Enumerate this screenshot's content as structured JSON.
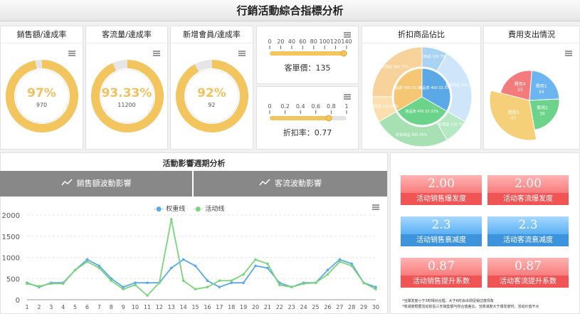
{
  "page_title": "行銷活動綜合指標分析",
  "gauges": [
    {
      "title": "銷售額/達成率",
      "value_text": "97%",
      "sub": "970",
      "percent": 97
    },
    {
      "title": "客流量/達成率",
      "value_text": "93.33%",
      "sub": "11200",
      "percent": 93.33
    },
    {
      "title": "新增會員/達成率",
      "value_text": "92%",
      "sub": "92",
      "percent": 92
    }
  ],
  "price_bar": {
    "ticks": [
      "0",
      "20",
      "40",
      "60",
      "80",
      "100",
      "120",
      "140"
    ],
    "label": "客單價：135",
    "value": 135,
    "max": 140
  },
  "discount_bar": {
    "ticks": [
      "0",
      "0.2",
      "0.4",
      "0.6",
      "0.8",
      "1"
    ],
    "label": "折扣率：0.77",
    "value": 0.77,
    "max": 1
  },
  "discount_pie": {
    "title": "折扣商品佔比",
    "inner_labels": [
      "商品表 400 33.33%",
      "商品表 400 33.33%",
      "商品表 400 33.33%"
    ],
    "outer_labels": [
      "折扣商品 100 75%",
      "折扣商品 300 25%",
      "折扣商品 100 75%",
      "折扣商品 300 25%",
      "折扣商品 100 25%",
      "折扣商品 300 75%"
    ]
  },
  "expense_pie": {
    "title": "費用支出情況",
    "slices": [
      {
        "label": "費用4",
        "value_text": "33",
        "value": 33,
        "color": "#f47b7b"
      },
      {
        "label": "費用1",
        "value_text": "34",
        "value": 34,
        "color": "#6cb5f0"
      },
      {
        "label": "費用2",
        "value_text": "34",
        "value": 34,
        "color": "#6bd48a"
      },
      {
        "label": "費用3",
        "value_text": "47",
        "value": 47,
        "color": "#f5d078"
      }
    ]
  },
  "cycle": {
    "title": "活動影響週期分析",
    "tab_sales": "銷售額波動影響",
    "tab_traffic": "客流波動影響",
    "legend_a": "权重线",
    "legend_b": "活动线"
  },
  "kpis": [
    {
      "value": "2.00",
      "label": "活动销售爆发度",
      "color": "red"
    },
    {
      "value": "2.00",
      "label": "活动客流爆发度",
      "color": "red"
    },
    {
      "value": "2.3",
      "label": "活动销售衰减度",
      "color": "blue"
    },
    {
      "value": "2.3",
      "label": "活动客流衰减度",
      "color": "blue"
    },
    {
      "value": "0.87",
      "label": "活动销售提升系数",
      "color": "red"
    },
    {
      "value": "0.87",
      "label": "活动客流提升系数",
      "color": "red"
    }
  ],
  "notes": [
    "*当爆发度小于3时相对合理，大于6时会出现促销过度现象",
    "*衰减度根据活动前后三天销售额与权合值差比，当衰减度大于爆发度时，活动价值不大"
  ],
  "chart_data": {
    "type": "line",
    "x": [
      1,
      2,
      3,
      4,
      5,
      6,
      7,
      8,
      9,
      10,
      11,
      12,
      13,
      14,
      15,
      16,
      17,
      18,
      19,
      20,
      21,
      22,
      23,
      24,
      25,
      26,
      27,
      28,
      29,
      30
    ],
    "ylim": [
      0,
      2000
    ],
    "yticks": [
      "0",
      "500",
      "1000",
      "1500",
      "2000"
    ],
    "series": [
      {
        "name": "权重线",
        "color": "#5aa9e6",
        "values": [
          400,
          300,
          400,
          400,
          700,
          950,
          800,
          500,
          300,
          400,
          400,
          400,
          750,
          950,
          800,
          450,
          300,
          400,
          400,
          800,
          750,
          400,
          300,
          400,
          400,
          700,
          950,
          850,
          400,
          300
        ]
      },
      {
        "name": "活动线",
        "color": "#7bd47b",
        "values": [
          380,
          320,
          380,
          380,
          700,
          900,
          750,
          450,
          250,
          350,
          100,
          400,
          1900,
          450,
          250,
          300,
          450,
          450,
          600,
          950,
          850,
          350,
          300,
          380,
          400,
          600,
          900,
          800,
          400,
          250
        ]
      }
    ]
  },
  "colors": {
    "gauge_fill": "#f3c55f",
    "gauge_track": "#e6e6e6",
    "line_a": "#5aa9e6",
    "line_b": "#7bd47b"
  },
  "icons": [
    "menu-icon",
    "line-chart-icon"
  ]
}
